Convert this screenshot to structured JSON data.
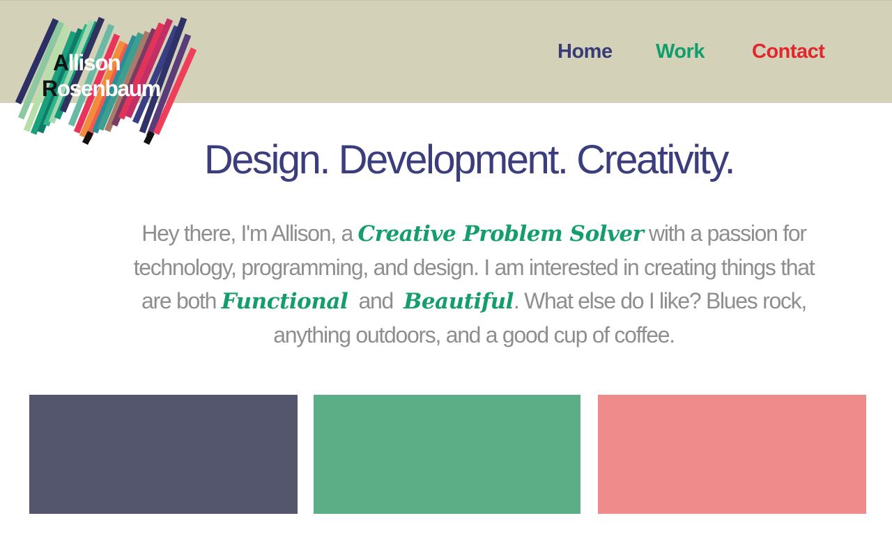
{
  "brand": {
    "first_initial": "A",
    "first_rest": "llison",
    "last_initial": "R",
    "last_rest": "osenbaum"
  },
  "nav": {
    "home": "Home",
    "work": "Work",
    "contact": "Contact"
  },
  "hero": {
    "headline": "Design. Development. Creativity.",
    "intro": {
      "part1": "Hey there, I'm Allison, a ",
      "highlight1": "Creative Problem Solver",
      "part2": " with a passion for technology, programming, and design. I am interested in creating things that are both ",
      "highlight2": "Functional",
      "part3": "  and  ",
      "highlight3": "Beautiful",
      "part4": ".  What else do I like?  Blues rock,  anything outdoors,  and a good cup of  coffee."
    }
  },
  "colors": {
    "header_bg": "#d3d1b8",
    "nav_home": "#383b78",
    "nav_work": "#129d6c",
    "nav_contact": "#e3262e",
    "headline": "#3b3d7c",
    "highlight": "#139e6b",
    "tile_1": "#53566c",
    "tile_2": "#5cae86",
    "tile_3": "#ef8c8b"
  }
}
